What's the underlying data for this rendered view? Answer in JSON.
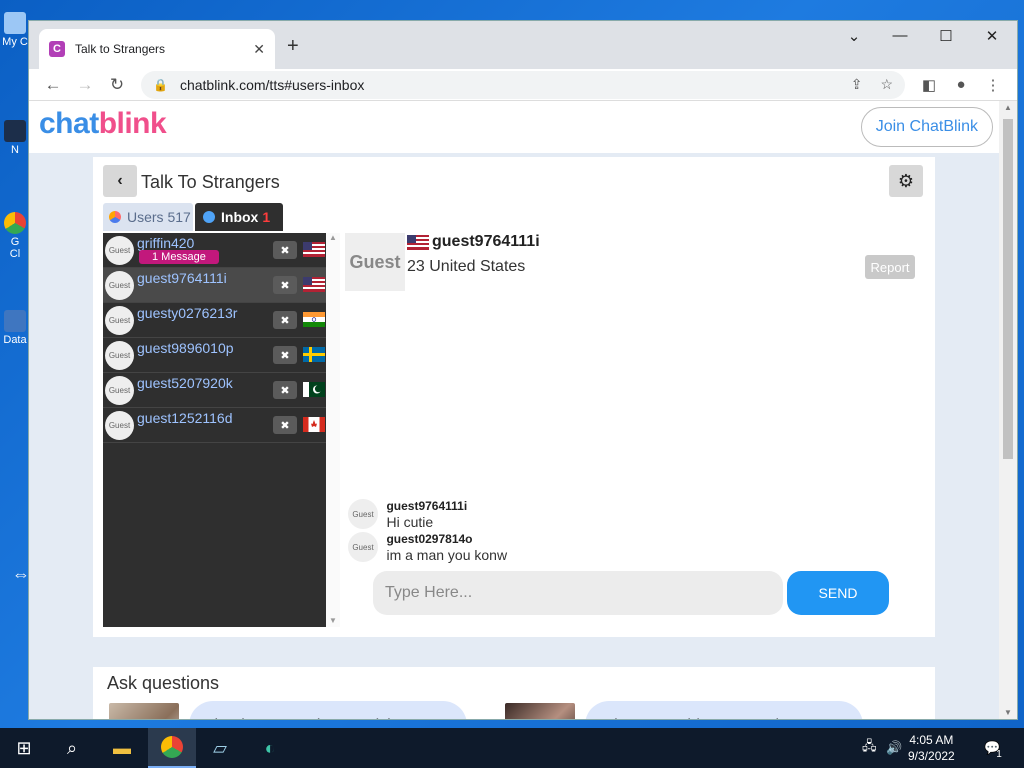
{
  "desktop": {
    "icons": [
      {
        "label": "My C",
        "name": "my-computer"
      },
      {
        "label": "N",
        "name": "network"
      },
      {
        "label": "G",
        "name": "google-chrome-shortcut"
      },
      {
        "label": "Cl",
        "name": "chrome-shortcut-line2"
      },
      {
        "label": "Data",
        "name": "data-shortcut"
      }
    ]
  },
  "browser": {
    "tab_title": "Talk to Strangers",
    "tab_favicon": "C",
    "new_tab": "+",
    "url": "chatblink.com/tts#users-inbox"
  },
  "site": {
    "logo_part1": "chat",
    "logo_part2": "blink",
    "join_label": "Join ChatBlink",
    "page_title": "Talk To Strangers",
    "tabs": {
      "users_label": "Users 517",
      "inbox_label": "Inbox",
      "inbox_count": "1"
    },
    "users": [
      {
        "name": "griffin420",
        "badge": "1 Message",
        "flag": "us",
        "selected": false
      },
      {
        "name": "guest9764111i",
        "badge": "",
        "flag": "us",
        "selected": true
      },
      {
        "name": "guesty0276213r",
        "badge": "",
        "flag": "in",
        "selected": false
      },
      {
        "name": "guest9896010p",
        "badge": "",
        "flag": "se",
        "selected": false
      },
      {
        "name": "guest5207920k",
        "badge": "",
        "flag": "pk",
        "selected": false
      },
      {
        "name": "guest1252116d",
        "badge": "",
        "flag": "ca",
        "selected": false
      }
    ],
    "avatar_label": "Guest",
    "chat": {
      "name": "guest9764111i",
      "subtitle": "23 United States",
      "report_label": "Report",
      "messages": [
        {
          "sender": "guest9764111i",
          "text": "Hi cutie"
        },
        {
          "sender": "guest0297814o",
          "text": "im a man you konw"
        }
      ],
      "input_placeholder": "Type Here...",
      "send_label": "SEND"
    },
    "ask": {
      "heading": "Ask questions",
      "questions": [
        {
          "text": "what language do you wish you"
        },
        {
          "text": "What's one thing no one knows"
        }
      ]
    }
  },
  "taskbar": {
    "time": "4:05 AM",
    "date": "9/3/2022",
    "notification_count": "1"
  },
  "colors": {
    "accent_blue": "#2196f3",
    "logo_blue": "#3a8ee6",
    "logo_pink": "#f04f8b",
    "badge_magenta": "#c2187c",
    "list_bg": "#2f2f2f"
  }
}
